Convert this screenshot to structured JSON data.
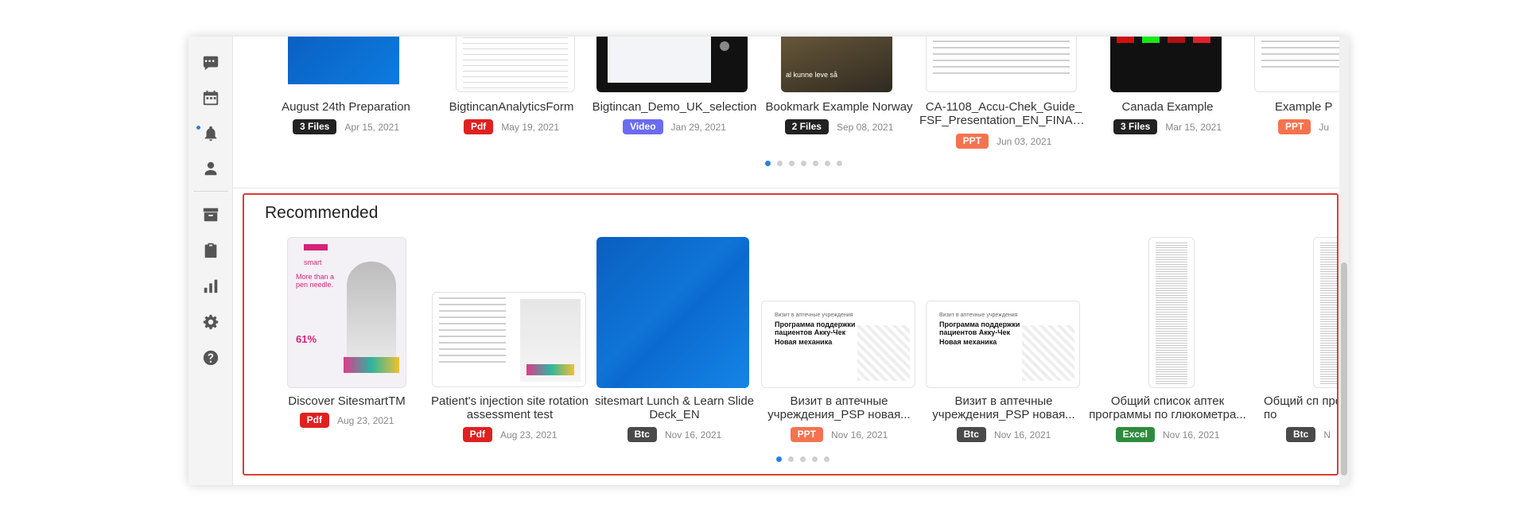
{
  "nav_rail": {
    "items": [
      {
        "icon": "chat-icon"
      },
      {
        "icon": "calendar-icon"
      },
      {
        "icon": "bell-icon"
      },
      {
        "icon": "user-icon"
      },
      {
        "icon": "archive-icon"
      },
      {
        "icon": "clipboard-icon"
      },
      {
        "icon": "bar-chart-icon"
      },
      {
        "icon": "gear-icon"
      },
      {
        "icon": "help-icon"
      }
    ]
  },
  "top_row": {
    "cards": [
      {
        "title": "August 24th Preparation",
        "badge": "3 Files",
        "badge_color": "#222222",
        "date": "Apr 15, 2021"
      },
      {
        "title": "BigtincanAnalyticsForm",
        "badge": "Pdf",
        "badge_color": "#e02020",
        "date": "May 19, 2021"
      },
      {
        "title": "Bigtincan_Demo_UK_selection",
        "badge": "Video",
        "badge_color": "#6b6bf0",
        "date": "Jan 29, 2021"
      },
      {
        "title": "Bookmark Example Norway",
        "badge": "2 Files",
        "badge_color": "#222222",
        "date": "Sep 08, 2021"
      },
      {
        "title": "CA-1108_Accu-Chek_Guide_ FSF_Presentation_EN_FINAL...",
        "badge": "PPT",
        "badge_color": "#f4734f",
        "date": "Jun 03, 2021"
      },
      {
        "title": "Canada Example",
        "badge": "3 Files",
        "badge_color": "#222222",
        "date": "Mar 15, 2021"
      },
      {
        "title": "Example P",
        "badge": "PPT",
        "badge_color": "#f4734f",
        "date": "Ju"
      }
    ],
    "thumb_caption": "al kunne leve så"
  },
  "recommended": {
    "title": "Recommended",
    "cards": [
      {
        "title": "Discover SitesmartTM",
        "badge": "Pdf",
        "badge_color": "#e02020",
        "date": "Aug 23, 2021"
      },
      {
        "title": "Patient's injection site rotation assessment test",
        "badge": "Pdf",
        "badge_color": "#e02020",
        "date": "Aug 23, 2021"
      },
      {
        "title": "sitesmart Lunch & Learn Slide Deck_EN",
        "badge": "Btc",
        "badge_color": "#4a4a4a",
        "date": "Nov 16, 2021"
      },
      {
        "title": "Визит в аптечные учреждения_PSP новая...",
        "badge": "PPT",
        "badge_color": "#f4734f",
        "date": "Nov 16, 2021"
      },
      {
        "title": "Визит в аптечные учреждения_PSP новая...",
        "badge": "Btc",
        "badge_color": "#4a4a4a",
        "date": "Nov 16, 2021"
      },
      {
        "title": "Общий список аптек программы по глюкометра...",
        "badge": "Excel",
        "badge_color": "#2e8b3e",
        "date": "Nov 16, 2021"
      },
      {
        "title": "Общий сп программы по",
        "badge": "Btc",
        "badge_color": "#4a4a4a",
        "date": "N"
      }
    ],
    "slide_texts": {
      "brand": "smart",
      "heading1": "More than a pen needle.",
      "stat": "61%",
      "slide_small": "Визит в аптечные учреждения",
      "slide_big": "Программа поддержки пациентов Акку-Чек",
      "slide_sub": "Новая механика"
    }
  },
  "colors": {
    "accent": "#2a7fe0",
    "highlight": "#e03a3a"
  }
}
